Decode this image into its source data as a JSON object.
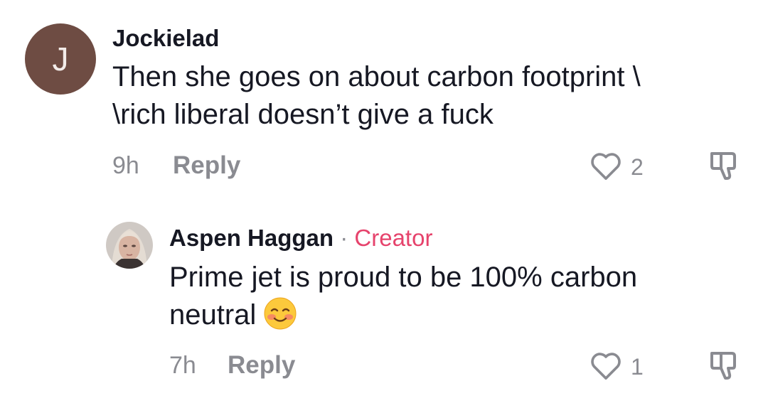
{
  "comments": [
    {
      "username": "Jockielad",
      "avatar_letter": "J",
      "text_line1": "Then she goes on about carbon footprint \\",
      "text_line2": "\\rich liberal doesn’t give a fuck",
      "time": "9h",
      "reply_label": "Reply",
      "likes": "2"
    },
    {
      "username": "Aspen Haggan",
      "separator": "·",
      "badge": "Creator",
      "text_line1": "Prime jet is proud to be 100% carbon",
      "text_line2": "neutral",
      "emoji": "smiling-blushing-face",
      "time": "7h",
      "reply_label": "Reply",
      "likes": "1"
    }
  ],
  "icons": {
    "like": "heart-outline-icon",
    "dislike": "thumbs-down-icon"
  },
  "colors": {
    "avatar_bg": "#6e4c43",
    "creator_badge": "#e6436c",
    "secondary_text": "#8a8b91",
    "primary_text": "#161823"
  }
}
